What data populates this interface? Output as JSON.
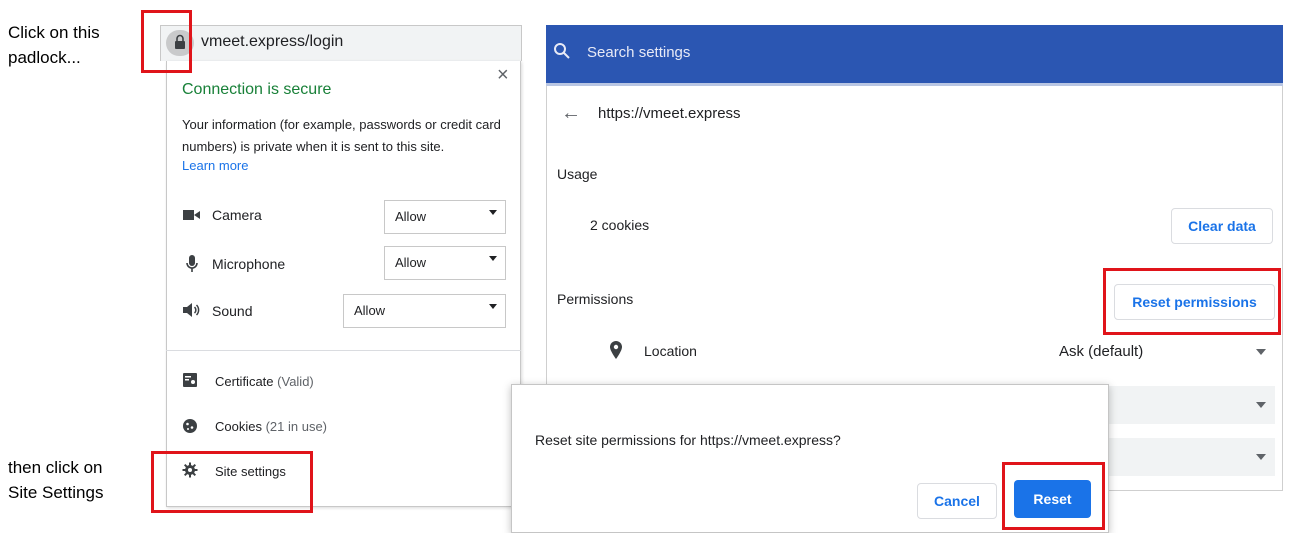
{
  "annotations": {
    "padlock_note": [
      "Click on this",
      "padlock..."
    ],
    "site_settings_note": [
      "then click on",
      "Site Settings"
    ]
  },
  "popup": {
    "url": "vmeet.express/login",
    "close_glyph": "×",
    "connection_title": "Connection is secure",
    "connection_description": "Your information (for example, passwords or credit card numbers) is private when it is sent to this site.",
    "learn_more": "Learn more",
    "permissions": [
      {
        "label": "Camera",
        "value": "Allow",
        "icon": "camera-icon"
      },
      {
        "label": "Microphone",
        "value": "Allow",
        "icon": "microphone-icon"
      },
      {
        "label": "Sound",
        "value": "Allow",
        "icon": "speaker-icon"
      }
    ],
    "certificate": {
      "label": "Certificate",
      "status": "(Valid)"
    },
    "cookies": {
      "label": "Cookies",
      "status": "(21 in use)"
    },
    "site_settings": "Site settings"
  },
  "settings": {
    "search_placeholder": "Search settings",
    "site_url": "https://vmeet.express",
    "usage_heading": "Usage",
    "cookies_count": "2 cookies",
    "clear_data": "Clear data",
    "permissions_heading": "Permissions",
    "reset_permissions": "Reset permissions",
    "location_label": "Location",
    "location_value": "Ask (default)"
  },
  "dialog": {
    "message": "Reset site permissions for https://vmeet.express?",
    "cancel": "Cancel",
    "reset": "Reset"
  },
  "colors": {
    "highlight": "#e0141a",
    "header_blue": "#2b56b2",
    "accent_blue": "#1a73e8",
    "secure_green": "#188038"
  }
}
